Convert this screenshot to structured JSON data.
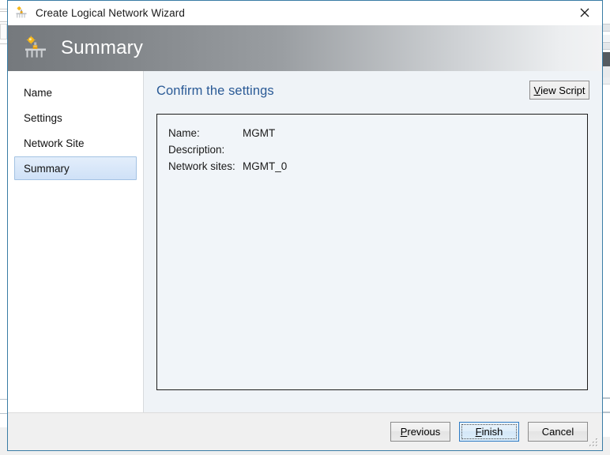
{
  "window": {
    "title": "Create Logical Network Wizard",
    "title_icon": "logical-network-icon",
    "close_icon": "close-icon"
  },
  "header": {
    "title": "Summary",
    "icon": "logical-network-icon"
  },
  "nav": {
    "items": [
      {
        "label": "Name",
        "selected": false
      },
      {
        "label": "Settings",
        "selected": false
      },
      {
        "label": "Network Site",
        "selected": false
      },
      {
        "label": "Summary",
        "selected": true
      }
    ]
  },
  "content": {
    "title": "Confirm the settings",
    "view_script": {
      "accel": "V",
      "rest": "iew Script"
    },
    "summary": [
      {
        "label": "Name:",
        "value": "MGMT"
      },
      {
        "label": "Description:",
        "value": ""
      },
      {
        "label": "Network sites:",
        "value": "MGMT_0"
      }
    ]
  },
  "footer": {
    "previous": {
      "accel": "P",
      "rest": "revious"
    },
    "finish": {
      "accel": "F",
      "rest": "inish"
    },
    "cancel": {
      "accel": "",
      "rest": "Cancel"
    },
    "grip_icon": "resize-grip-icon"
  },
  "colors": {
    "accent_title": "#2a5a96",
    "dialog_border": "#3a7ca5",
    "header_gradient_start": "#75797d",
    "header_gradient_end": "#f2f3f4",
    "selected_nav_border": "#a3c2e3",
    "default_button_border": "#2f7bc4"
  }
}
